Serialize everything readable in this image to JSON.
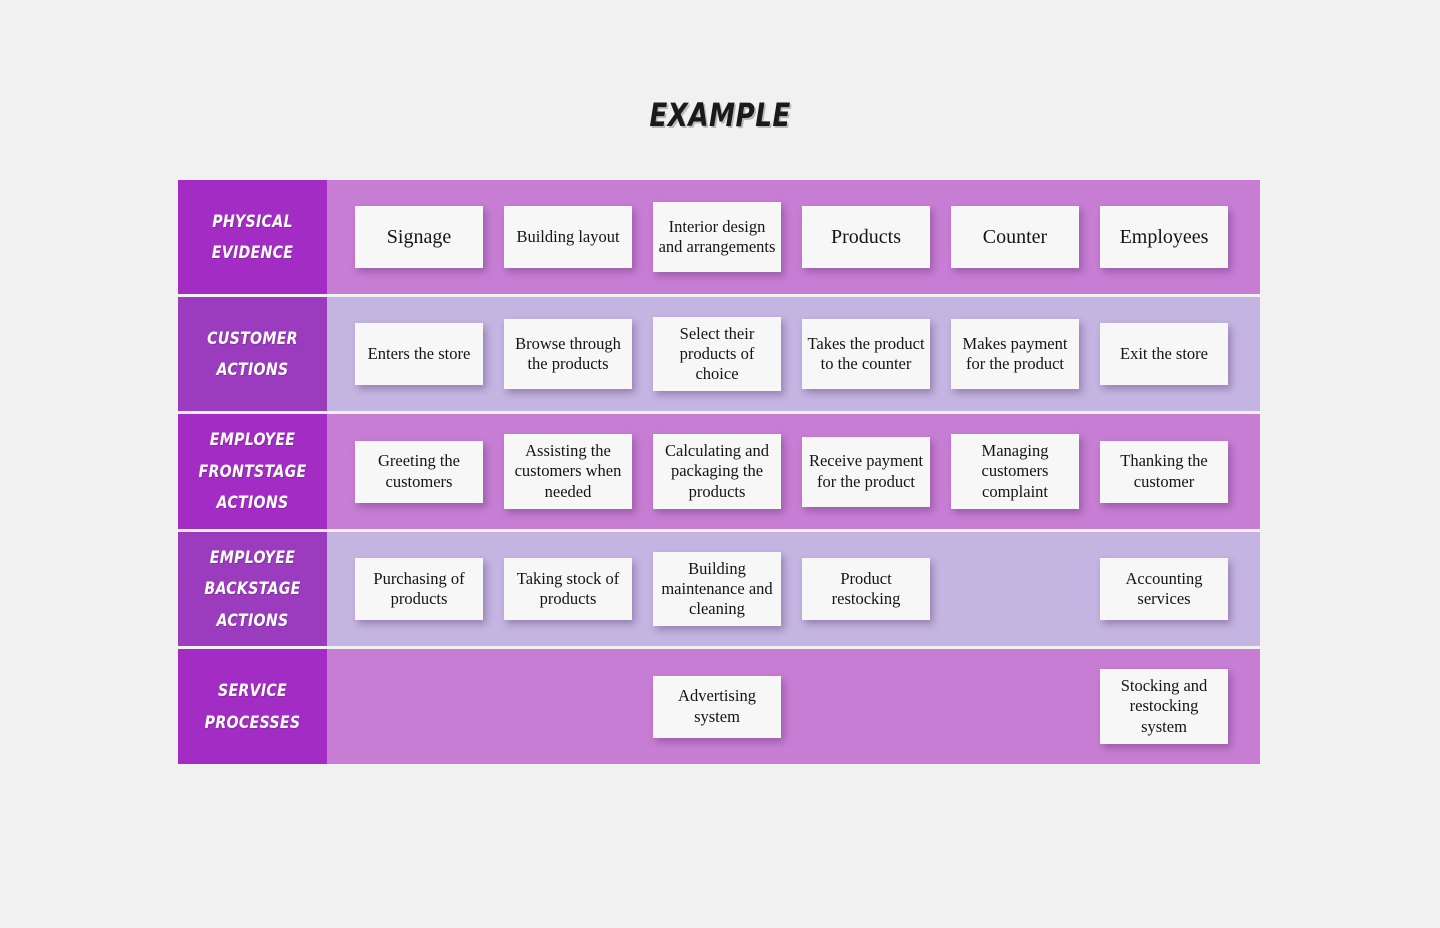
{
  "title": "EXAMPLE",
  "colors": {
    "background": "#f1f1f1",
    "label_dark": "#a32cc4",
    "label_alt": "#9b3bbd",
    "band_orchid": "#c77dd4",
    "band_lavender": "#c4b4e2",
    "card_bg": "#f7f7f8",
    "card_text": "#141414",
    "label_text": "#ffffff"
  },
  "rows": [
    {
      "id": "physical-evidence",
      "label": "PHYSICAL EVIDENCE",
      "band": "a",
      "cells": [
        {
          "text": "Signage",
          "lines": 1
        },
        {
          "text": "Building layout",
          "lines": 2
        },
        {
          "text": "Interior design and arrangements",
          "lines": 3
        },
        {
          "text": "Products",
          "lines": 1
        },
        {
          "text": "Counter",
          "lines": 1
        },
        {
          "text": "Employees",
          "lines": 1
        }
      ]
    },
    {
      "id": "customer-actions",
      "label": "CUSTOMER ACTIONS",
      "band": "b",
      "cells": [
        {
          "text": "Enters the store",
          "lines": 2
        },
        {
          "text": "Browse through the products",
          "lines": 3
        },
        {
          "text": "Select their products of choice",
          "lines": 3
        },
        {
          "text": "Takes the product to the counter",
          "lines": 3
        },
        {
          "text": "Makes payment for the product",
          "lines": 3
        },
        {
          "text": "Exit the store",
          "lines": 2
        }
      ]
    },
    {
      "id": "employee-frontstage-actions",
      "label": "EMPLOYEE FRONTSTAGE ACTIONS",
      "band": "a",
      "cells": [
        {
          "text": "Greeting the customers",
          "lines": 2
        },
        {
          "text": "Assisting the customers when needed",
          "lines": 3
        },
        {
          "text": "Calculating and packaging the products",
          "lines": 3
        },
        {
          "text": "Receive payment for the product",
          "lines": 3
        },
        {
          "text": "Managing customers complaint",
          "lines": 3
        },
        {
          "text": "Thanking the customer",
          "lines": 2
        }
      ]
    },
    {
      "id": "employee-backstage-actions",
      "label": "EMPLOYEE BACKSTAGE ACTIONS",
      "band": "b",
      "cells": [
        {
          "text": "Purchasing of products",
          "lines": 2
        },
        {
          "text": "Taking stock of products",
          "lines": 2
        },
        {
          "text": "Building maintenance and cleaning",
          "lines": 3
        },
        {
          "text": "Product restocking",
          "lines": 2
        },
        {
          "text": "",
          "lines": 0
        },
        {
          "text": "Accounting services",
          "lines": 2
        }
      ]
    },
    {
      "id": "service-processes",
      "label": "SERVICE PROCESSES",
      "band": "a",
      "cells": [
        {
          "text": "",
          "lines": 0
        },
        {
          "text": "",
          "lines": 0
        },
        {
          "text": "Advertising system",
          "lines": 2
        },
        {
          "text": "",
          "lines": 0
        },
        {
          "text": "",
          "lines": 0
        },
        {
          "text": "Stocking and restocking system",
          "lines": 3
        }
      ]
    }
  ]
}
